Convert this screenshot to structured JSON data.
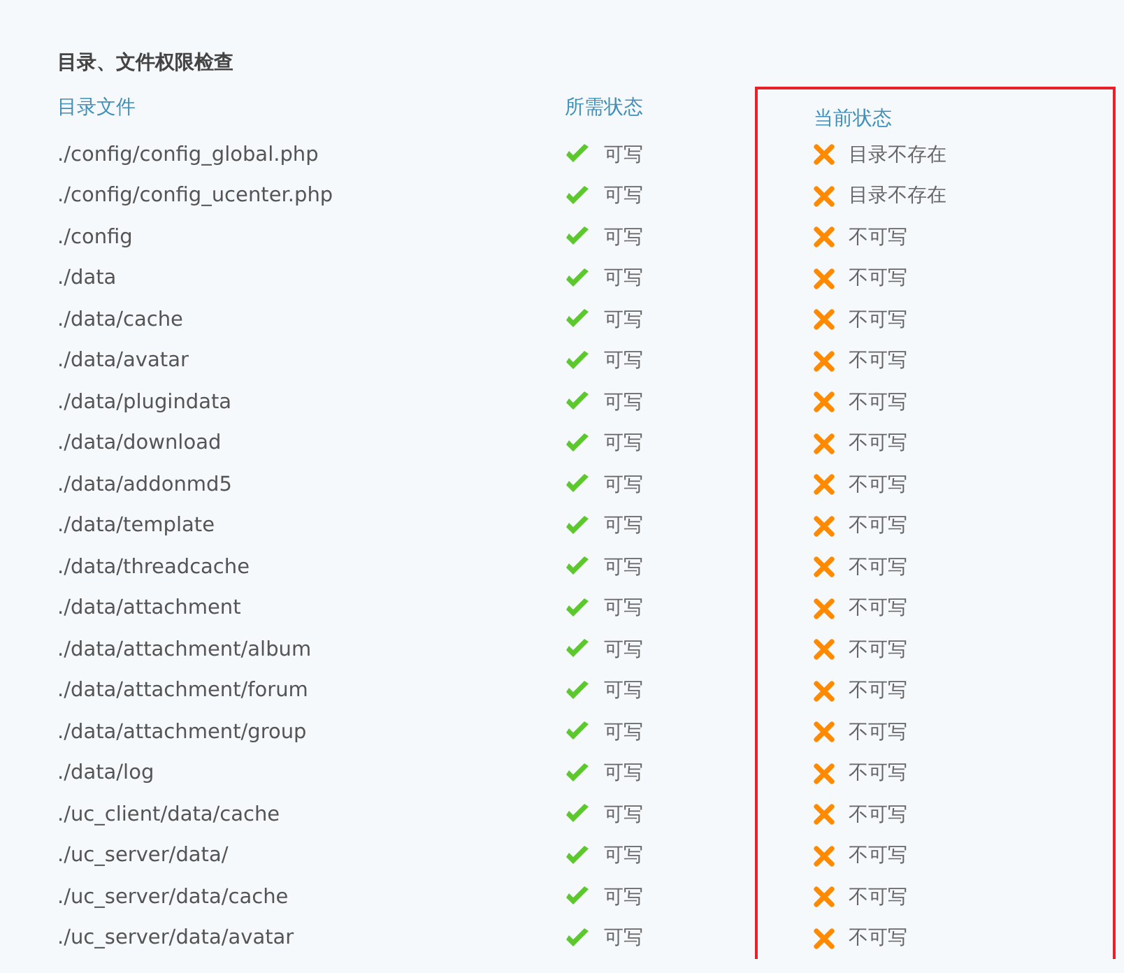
{
  "section_title": "目录、文件权限检查",
  "columns": [
    "目录文件",
    "所需状态",
    "当前状态"
  ],
  "rows": [
    {
      "path": "./config/config_global.php",
      "required": {
        "ok": true,
        "text": "可写"
      },
      "current": {
        "ok": false,
        "text": "目录不存在"
      }
    },
    {
      "path": "./config/config_ucenter.php",
      "required": {
        "ok": true,
        "text": "可写"
      },
      "current": {
        "ok": false,
        "text": "目录不存在"
      }
    },
    {
      "path": "./config",
      "required": {
        "ok": true,
        "text": "可写"
      },
      "current": {
        "ok": false,
        "text": "不可写"
      }
    },
    {
      "path": "./data",
      "required": {
        "ok": true,
        "text": "可写"
      },
      "current": {
        "ok": false,
        "text": "不可写"
      }
    },
    {
      "path": "./data/cache",
      "required": {
        "ok": true,
        "text": "可写"
      },
      "current": {
        "ok": false,
        "text": "不可写"
      }
    },
    {
      "path": "./data/avatar",
      "required": {
        "ok": true,
        "text": "可写"
      },
      "current": {
        "ok": false,
        "text": "不可写"
      }
    },
    {
      "path": "./data/plugindata",
      "required": {
        "ok": true,
        "text": "可写"
      },
      "current": {
        "ok": false,
        "text": "不可写"
      }
    },
    {
      "path": "./data/download",
      "required": {
        "ok": true,
        "text": "可写"
      },
      "current": {
        "ok": false,
        "text": "不可写"
      }
    },
    {
      "path": "./data/addonmd5",
      "required": {
        "ok": true,
        "text": "可写"
      },
      "current": {
        "ok": false,
        "text": "不可写"
      }
    },
    {
      "path": "./data/template",
      "required": {
        "ok": true,
        "text": "可写"
      },
      "current": {
        "ok": false,
        "text": "不可写"
      }
    },
    {
      "path": "./data/threadcache",
      "required": {
        "ok": true,
        "text": "可写"
      },
      "current": {
        "ok": false,
        "text": "不可写"
      }
    },
    {
      "path": "./data/attachment",
      "required": {
        "ok": true,
        "text": "可写"
      },
      "current": {
        "ok": false,
        "text": "不可写"
      }
    },
    {
      "path": "./data/attachment/album",
      "required": {
        "ok": true,
        "text": "可写"
      },
      "current": {
        "ok": false,
        "text": "不可写"
      }
    },
    {
      "path": "./data/attachment/forum",
      "required": {
        "ok": true,
        "text": "可写"
      },
      "current": {
        "ok": false,
        "text": "不可写"
      }
    },
    {
      "path": "./data/attachment/group",
      "required": {
        "ok": true,
        "text": "可写"
      },
      "current": {
        "ok": false,
        "text": "不可写"
      }
    },
    {
      "path": "./data/log",
      "required": {
        "ok": true,
        "text": "可写"
      },
      "current": {
        "ok": false,
        "text": "不可写"
      }
    },
    {
      "path": "./uc_client/data/cache",
      "required": {
        "ok": true,
        "text": "可写"
      },
      "current": {
        "ok": false,
        "text": "不可写"
      }
    },
    {
      "path": "./uc_server/data/",
      "required": {
        "ok": true,
        "text": "可写"
      },
      "current": {
        "ok": false,
        "text": "不可写"
      }
    },
    {
      "path": "./uc_server/data/cache",
      "required": {
        "ok": true,
        "text": "可写"
      },
      "current": {
        "ok": false,
        "text": "不可写"
      }
    },
    {
      "path": "./uc_server/data/avatar",
      "required": {
        "ok": true,
        "text": "可写"
      },
      "current": {
        "ok": false,
        "text": "不可写"
      }
    }
  ]
}
